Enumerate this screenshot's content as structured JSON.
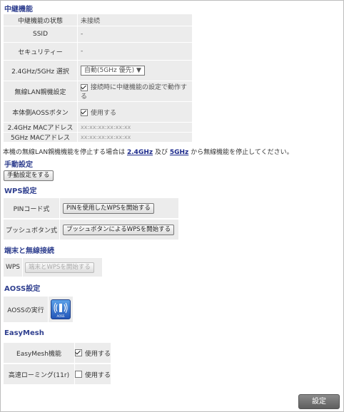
{
  "relay": {
    "title": "中継機能",
    "rows": {
      "status": {
        "label": "中継機能の状態",
        "value": "未接続"
      },
      "ssid": {
        "label": "SSID",
        "value": "-"
      },
      "security": {
        "label": "セキュリティー",
        "value": "-"
      },
      "band": {
        "label": "2.4GHz/5GHz 選択",
        "value": "自動(5GHz 優先)"
      },
      "wlan_parent": {
        "label": "無線LAN親機設定",
        "value": "接続時に中継機能の設定で動作する",
        "checked": true
      },
      "aoss_button": {
        "label": "本体側AOSSボタン",
        "value": "使用する",
        "checked": true
      },
      "mac24": {
        "label": "2.4GHz MACアドレス",
        "value": "xx:xx:xx:xx:xx:xx"
      },
      "mac5": {
        "label": "5GHz MACアドレス",
        "value": "xx:xx:xx:xx:xx:xx"
      }
    },
    "note_prefix": "本機の無線LAN親機機能を停止する場合は",
    "note_link1": "2.4GHz",
    "note_mid": "及び",
    "note_link2": "5GHz",
    "note_suffix": "から無線機能を停止してください。"
  },
  "manual": {
    "title": "手動設定",
    "button": "手動設定をする"
  },
  "wps": {
    "title": "WPS設定",
    "pin_label": "PINコード式",
    "pin_button": "PINを使用したWPSを開始する",
    "push_label": "プッシュボタン式",
    "push_button": "プッシュボタンによるWPSを開始する"
  },
  "terminal": {
    "title": "端末と無線接続",
    "wps_label": "WPS",
    "wps_button": "端末とWPSを開始する"
  },
  "aoss": {
    "title": "AOSS設定",
    "label": "AOSSの実行",
    "icon_text": "AOSS"
  },
  "easymesh": {
    "title": "EasyMesh",
    "func_label": "EasyMesh機能",
    "func_value": "使用する",
    "func_checked": true,
    "roam_label": "高速ローミング(11r)",
    "roam_value": "使用する",
    "roam_checked": false
  },
  "save_button": "設定",
  "colors": {
    "heading": "#2f3f8f",
    "cell_bg": "#ececec",
    "link": "#1c2a8c"
  }
}
